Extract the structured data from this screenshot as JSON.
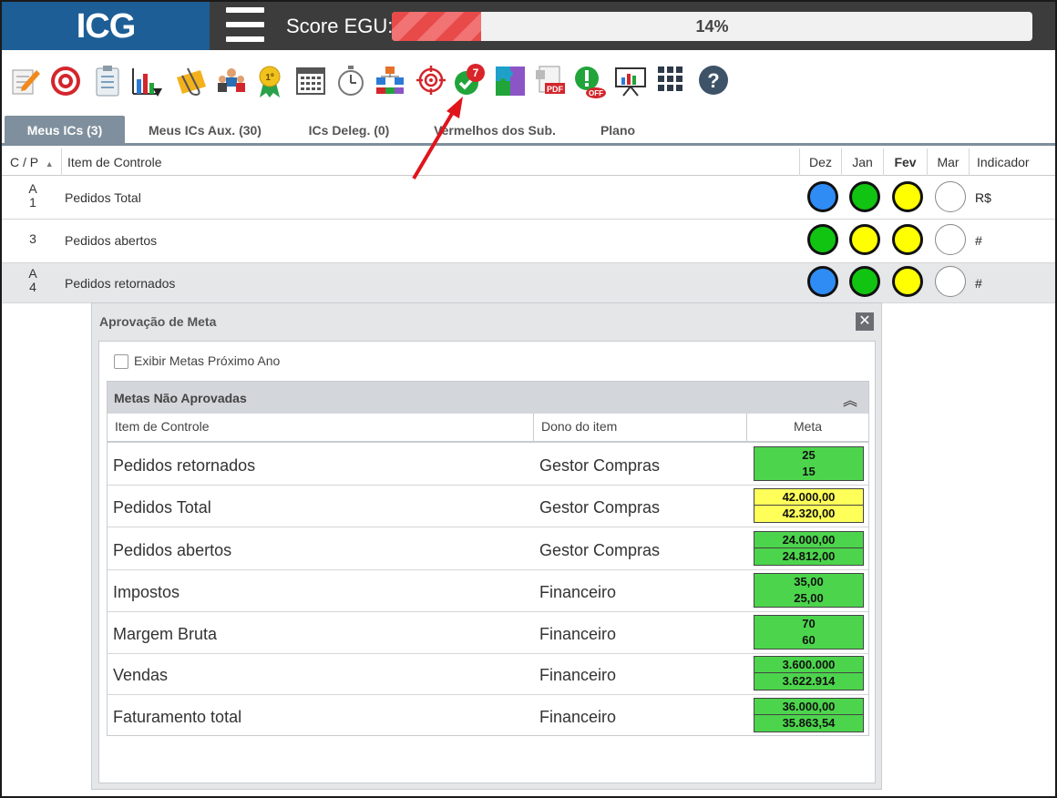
{
  "header": {
    "logo": "ICG",
    "score_label": "Score EGU:",
    "score_percent": "14%",
    "score_fraction": 0.14,
    "score_color": "#e84a4a"
  },
  "toolbar": {
    "icons": [
      "edit-icon",
      "target-icon",
      "clipboard-icon",
      "bar-chart-icon",
      "folder-clip-icon",
      "team-icon",
      "award-icon",
      "calendar-icon",
      "stopwatch-icon",
      "org-chart-icon",
      "crosshair-icon",
      "approval-check-icon",
      "puzzle-icon",
      "pdf-icon",
      "alert-off-icon",
      "presentation-icon",
      "grid-icon",
      "help-icon"
    ],
    "approval_badge": "7"
  },
  "tabs": [
    {
      "label": "Meus ICs (3)",
      "active": true
    },
    {
      "label": "Meus ICs Aux. (30)",
      "active": false
    },
    {
      "label": "ICs Deleg. (0)",
      "active": false
    },
    {
      "label": "Vermelhos dos Sub.",
      "active": false
    },
    {
      "label": "Plano",
      "active": false
    }
  ],
  "grid": {
    "columns": {
      "cp": "C / P",
      "item": "Item de Controle",
      "dez": "Dez",
      "jan": "Jan",
      "fev": "Fev",
      "mar": "Mar",
      "indicador": "Indicador"
    },
    "rows": [
      {
        "cp_top": "A",
        "cp_bottom": "1",
        "name": "Pedidos Total",
        "indicator": "R$",
        "dots": [
          "#2f8cf5",
          "#11c411",
          "#ffff00",
          "#ffffff"
        ]
      },
      {
        "cp_top": "",
        "cp_bottom": "3",
        "name": "Pedidos abertos",
        "indicator": "#",
        "dots": [
          "#11c411",
          "#ffff00",
          "#ffff00",
          "#ffffff"
        ]
      },
      {
        "cp_top": "A",
        "cp_bottom": "4",
        "name": "Pedidos retornados",
        "indicator": "#",
        "dots": [
          "#2f8cf5",
          "#11c411",
          "#ffff00",
          "#ffffff"
        ]
      }
    ]
  },
  "dialog": {
    "title": "Aprovação de Meta",
    "close": "✕",
    "checkbox_label": "Exibir Metas Próximo Ano",
    "panel_title": "Metas Não Aprovadas",
    "collapse_glyph": "︽",
    "columns": {
      "item": "Item de Controle",
      "owner": "Dono do item",
      "meta": "Meta"
    },
    "rows": [
      {
        "item": "Pedidos retornados",
        "owner": "Gestor Compras",
        "meta_top": "25",
        "meta_bottom": "15",
        "color": "green",
        "split": false
      },
      {
        "item": "Pedidos Total",
        "owner": "Gestor Compras",
        "meta_top": "42.000,00",
        "meta_bottom": "42.320,00",
        "color": "yellow",
        "split": true
      },
      {
        "item": "Pedidos abertos",
        "owner": "Gestor Compras",
        "meta_top": "24.000,00",
        "meta_bottom": "24.812,00",
        "color": "green",
        "split": true
      },
      {
        "item": "Impostos",
        "owner": "Financeiro",
        "meta_top": "35,00",
        "meta_bottom": "25,00",
        "color": "green",
        "split": false
      },
      {
        "item": "Margem Bruta",
        "owner": "Financeiro",
        "meta_top": "70",
        "meta_bottom": "60",
        "color": "green",
        "split": false
      },
      {
        "item": "Vendas",
        "owner": "Financeiro",
        "meta_top": "3.600.000",
        "meta_bottom": "3.622.914",
        "color": "green",
        "split": true
      },
      {
        "item": "Faturamento total",
        "owner": "Financeiro",
        "meta_top": "36.000,00",
        "meta_bottom": "35.863,54",
        "color": "green",
        "split": true
      }
    ]
  }
}
